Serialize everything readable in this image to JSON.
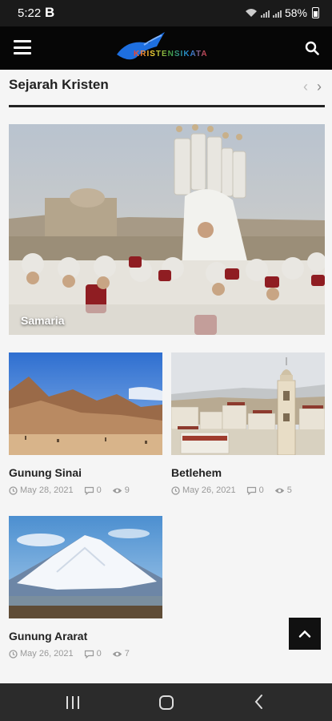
{
  "status_bar": {
    "time": "5:22",
    "app_letter": "B",
    "battery": "58%"
  },
  "header": {
    "logo_text": "KRISTENSIKATA",
    "icons": [
      "menu-icon",
      "search-icon"
    ]
  },
  "section": {
    "title": "Sejarah Kristen",
    "prev_glyph": "‹",
    "next_glyph": "›"
  },
  "hero": {
    "title": "Samaria"
  },
  "posts": [
    {
      "title": "Gunung Sinai",
      "date": "May 28, 2021",
      "comments": "0",
      "views": "9"
    },
    {
      "title": "Betlehem",
      "date": "May 26, 2021",
      "comments": "0",
      "views": "5"
    },
    {
      "title": "Gunung Ararat",
      "date": "May 26, 2021",
      "comments": "0",
      "views": "7"
    }
  ],
  "colors": {
    "header": "#060606",
    "status_bar": "#1a1a1a",
    "background": "#f5f5f5",
    "nav_bar": "#2b2b2b",
    "text": "#222222",
    "meta": "#999999"
  }
}
